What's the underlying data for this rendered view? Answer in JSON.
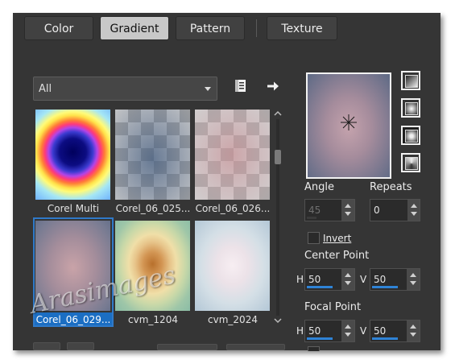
{
  "tabs": [
    {
      "label": "Color",
      "active": false
    },
    {
      "label": "Gradient",
      "active": true
    },
    {
      "label": "Pattern",
      "active": false
    },
    {
      "label": "Texture",
      "active": false
    }
  ],
  "category_select": {
    "value": "All"
  },
  "icons": {
    "toggle_view": "list-view-icon",
    "more": "arrow-right-icon"
  },
  "gradients": [
    {
      "label": "Corel Multi",
      "selected": false
    },
    {
      "label": "Corel_06_025...",
      "selected": false
    },
    {
      "label": "Corel_06_026...",
      "selected": false
    },
    {
      "label": "Corel_06_029...",
      "selected": true
    },
    {
      "label": "cvm_1204",
      "selected": false
    },
    {
      "label": "cvm_2024",
      "selected": false
    }
  ],
  "preview": {
    "marker": "center-point-icon"
  },
  "style_buttons": [
    "linear-style-icon",
    "rectangular-style-icon",
    "sunburst-style-icon",
    "radial-style-icon"
  ],
  "angle": {
    "label": "Angle",
    "value": "45",
    "enabled": false
  },
  "repeats": {
    "label": "Repeats",
    "value": "0"
  },
  "invert": {
    "label": "Invert",
    "checked": false
  },
  "center_point": {
    "label": "Center Point",
    "h_label": "H",
    "h_value": "50",
    "v_label": "V",
    "v_value": "50"
  },
  "focal_point": {
    "label": "Focal Point",
    "h_label": "H",
    "h_value": "50",
    "v_label": "V",
    "v_value": "50"
  },
  "watermark": "Arasimages",
  "colors": {
    "panel": "#353535",
    "selection": "#1b6ec3",
    "accent": "#2f83d6"
  }
}
